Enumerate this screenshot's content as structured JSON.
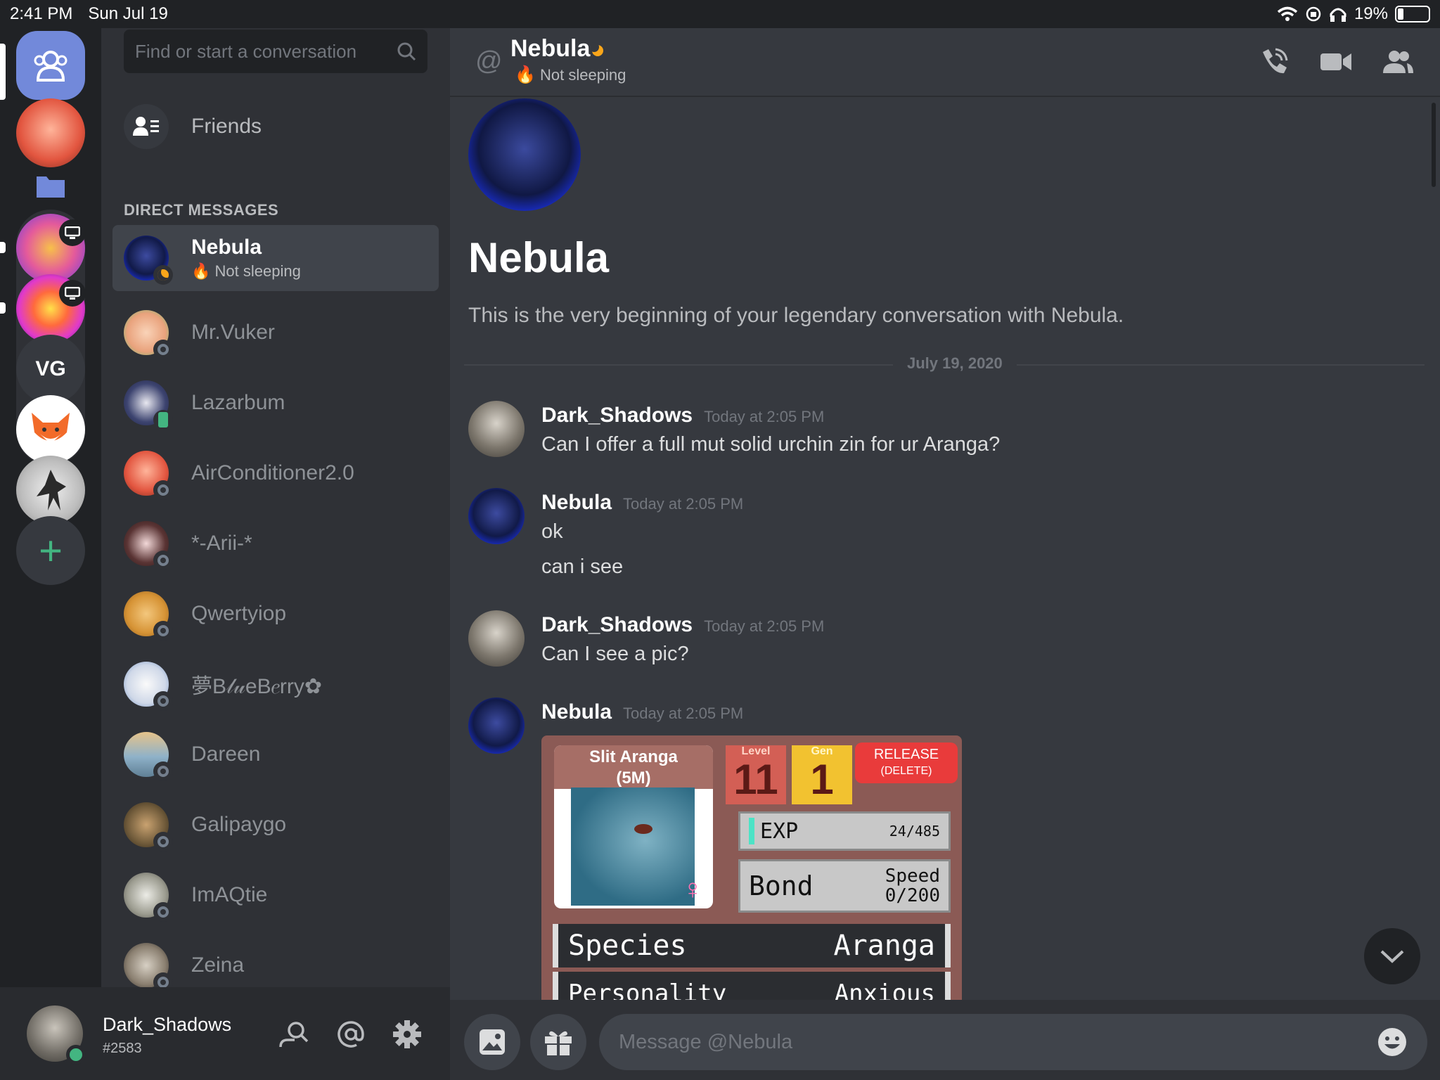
{
  "status_bar": {
    "time": "2:41 PM",
    "date": "Sun Jul 19",
    "battery": "19%",
    "battery_level": 0.19
  },
  "colors": {
    "blurple": "#7289da",
    "online": "#43b581",
    "idle": "#faa61a",
    "bg_main": "#36393f",
    "bg_side": "#2f3136"
  },
  "guilds": {
    "vg_label": "VG",
    "add_label": "+"
  },
  "dm_list": {
    "search_placeholder": "Find or start a conversation",
    "friends_label": "Friends",
    "header": "DIRECT MESSAGES",
    "items": [
      {
        "name": "Nebula",
        "status": "Not sleeping",
        "status_icon": "🔥"
      },
      {
        "name": "Mr.Vuker"
      },
      {
        "name": "Lazarbum"
      },
      {
        "name": "AirConditioner2.0"
      },
      {
        "name": "*-Arii-*"
      },
      {
        "name": "Qwertyiop"
      },
      {
        "name": "夢B𝓁𝓊eB𝑒rry✿"
      },
      {
        "name": "Dareen"
      },
      {
        "name": "Galipaygo"
      },
      {
        "name": "ImAQtie"
      },
      {
        "name": "Zeina"
      }
    ]
  },
  "user_panel": {
    "username": "Dark_Shadows",
    "discriminator": "#2583"
  },
  "channel": {
    "at_symbol": "@",
    "name": "Nebula",
    "status_icon": "🔥",
    "status": "Not sleeping",
    "intro_title": "Nebula",
    "intro_text": "This is the very beginning of your legendary conversation with Nebula.",
    "date_divider": "July 19, 2020"
  },
  "messages": [
    {
      "author": "Dark_Shadows",
      "time": "Today at 2:05 PM",
      "lines": [
        "Can I offer a full mut solid urchin zin for ur Aranga?"
      ]
    },
    {
      "author": "Nebula",
      "time": "Today at 2:05 PM",
      "lines": [
        "ok",
        "can i see"
      ]
    },
    {
      "author": "Dark_Shadows",
      "time": "Today at 2:05 PM",
      "lines": [
        "Can I see a pic?"
      ]
    },
    {
      "author": "Nebula",
      "time": "Today at 2:05 PM",
      "lines": []
    }
  ],
  "card": {
    "pet_title": "Slit Aranga",
    "pet_sub": "(5M)",
    "sex": "♀",
    "level_label": "Level",
    "level": "11",
    "gen_label": "Gen",
    "gen": "1",
    "release": "RELEASE",
    "release_sub": "(DELETE)",
    "exp_label": "EXP",
    "exp_value": "24/485",
    "bond_label": "Bond",
    "speed_label": "Speed",
    "speed_value": "0/200",
    "species_label": "Species",
    "species_value": "Aranga",
    "personality_label": "Personality",
    "personality_value": "Anxious"
  },
  "composer": {
    "placeholder": "Message @Nebula"
  }
}
